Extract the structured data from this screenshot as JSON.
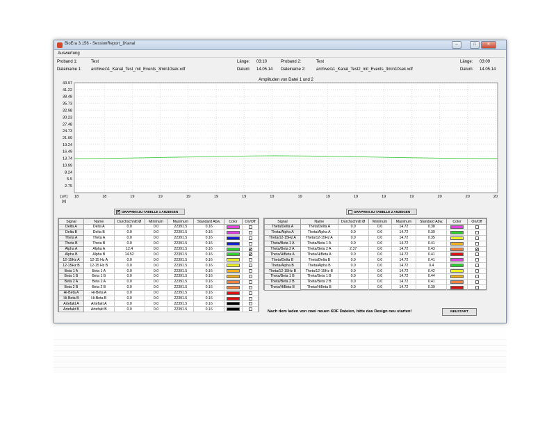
{
  "window": {
    "title": "BioEra 3.156 - SessionReport_1Kanal",
    "min_icon": "minimize-icon",
    "max_icon": "maximize-icon",
    "close_icon": "close-icon"
  },
  "menu": {
    "auswertung": "Auswertung"
  },
  "info": {
    "proband1_label": "Proband 1:",
    "proband1_value": "Test",
    "datei1_label": "Dateiname 1:",
    "datei1_value": "archives\\1_Kanal_Test_mit_Events_3min10sek.xdf",
    "laenge1_label": "Länge:",
    "laenge1_value": "03:10",
    "datum1_label": "Datum:",
    "datum1_value": "14.05.14",
    "proband2_label": "Proband 2:",
    "proband2_value": "Test",
    "datei2_label": "Dateiname 2:",
    "datei2_value": "archives\\1_Kanal_Test2_mit_Events_3min10sek.xdf",
    "laenge2_label": "Länge:",
    "laenge2_value": "03:09",
    "datum2_label": "Datum:",
    "datum2_value": "14.05.14"
  },
  "chart_data": {
    "type": "line",
    "title": "Amplituden von Datei 1 und 2",
    "ylabel": "[uV]",
    "xlabel": "[s]",
    "ylim": [
      0,
      43.97
    ],
    "y_ticks": [
      "43.97",
      "41.22",
      "38.48",
      "35.73",
      "32.98",
      "30.23",
      "27.48",
      "24.73",
      "21.99",
      "19.24",
      "16.49",
      "13.74",
      "10.99",
      "8.24",
      "5.5",
      "2.75"
    ],
    "x_ticks": [
      "18",
      "18",
      "19",
      "19",
      "19",
      "19",
      "19",
      "19",
      "19",
      "19",
      "19",
      "19",
      "19",
      "20",
      "20",
      "20"
    ],
    "grid": true,
    "line_color": "#44cc44",
    "series": [
      {
        "values": [
          13.6,
          13.7,
          13.8,
          13.95,
          14.1,
          14.25,
          14.4,
          14.55,
          14.7,
          14.75,
          14.7,
          14.6,
          14.45,
          14.3,
          14.15,
          14.0,
          13.85,
          13.75,
          13.7,
          13.65
        ]
      }
    ]
  },
  "table1": {
    "toggle_label": "GRAPHEN ZU TABELLE 1 ANZEIGEN",
    "toggle_checked": "✔",
    "headers": [
      "Signal",
      "Name",
      "Durchschnitt Ø",
      "Minimum",
      "Maximum",
      "Standard Abw.",
      "Color",
      "On/Off"
    ],
    "rows": [
      {
        "signal": "Delta A",
        "name": "Delta A",
        "avg": "0.0",
        "min": "0.0",
        "max": "22391.5",
        "std": "0.16",
        "color": "#e040e0",
        "on": ""
      },
      {
        "signal": "Delta B",
        "name": "Delta B",
        "avg": "0.0",
        "min": "0.0",
        "max": "22391.5",
        "std": "0.16",
        "color": "#e040e0",
        "on": ""
      },
      {
        "signal": "Theta A",
        "name": "Theta A",
        "avg": "0.0",
        "min": "0.0",
        "max": "22391.5",
        "std": "0.16",
        "color": "#1020d0",
        "on": ""
      },
      {
        "signal": "Theta B",
        "name": "Theta B",
        "avg": "0.0",
        "min": "0.0",
        "max": "22391.5",
        "std": "0.16",
        "color": "#1020d0",
        "on": ""
      },
      {
        "signal": "Alpha A",
        "name": "Alpha A",
        "avg": "12.4",
        "min": "0.0",
        "max": "22391.5",
        "std": "0.16",
        "color": "#30d030",
        "on": "✔"
      },
      {
        "signal": "Alpha B",
        "name": "Alpha B",
        "avg": "14.52",
        "min": "0.0",
        "max": "22391.5",
        "std": "0.16",
        "color": "#30d030",
        "on": "✔"
      },
      {
        "signal": "12-15Hz A",
        "name": "12-15 Hz A",
        "avg": "0.0",
        "min": "0.0",
        "max": "22391.5",
        "std": "0.16",
        "color": "#f0f020",
        "on": ""
      },
      {
        "signal": "12-15Hz B",
        "name": "12-15 Hz B",
        "avg": "0.0",
        "min": "0.0",
        "max": "22391.5",
        "std": "0.16",
        "color": "#f0f020",
        "on": ""
      },
      {
        "signal": "Beta 1 A",
        "name": "Beta 1 A",
        "avg": "0.0",
        "min": "0.0",
        "max": "22391.5",
        "std": "0.16",
        "color": "#f0b020",
        "on": ""
      },
      {
        "signal": "Beta 1 B",
        "name": "Beta 1 B",
        "avg": "0.0",
        "min": "0.0",
        "max": "22391.5",
        "std": "0.16",
        "color": "#f0b020",
        "on": ""
      },
      {
        "signal": "Beta 2 A",
        "name": "Beta 2 A",
        "avg": "0.0",
        "min": "0.0",
        "max": "22391.5",
        "std": "0.16",
        "color": "#f08040",
        "on": ""
      },
      {
        "signal": "Beta 2 B",
        "name": "Beta 2 B",
        "avg": "0.0",
        "min": "0.0",
        "max": "22391.5",
        "std": "0.16",
        "color": "#f08040",
        "on": ""
      },
      {
        "signal": "Hi-Beta A",
        "name": "Hi-Beta A",
        "avg": "0.0",
        "min": "0.0",
        "max": "22391.5",
        "std": "0.16",
        "color": "#e01010",
        "on": ""
      },
      {
        "signal": "Hi-Beta B",
        "name": "Hi-Beta B",
        "avg": "0.0",
        "min": "0.0",
        "max": "22391.5",
        "std": "0.16",
        "color": "#e01010",
        "on": ""
      },
      {
        "signal": "Artefakt A",
        "name": "Artefakt A",
        "avg": "0.0",
        "min": "0.0",
        "max": "22391.5",
        "std": "0.16",
        "color": "#000000",
        "on": ""
      },
      {
        "signal": "Artefakt B",
        "name": "Artefakt B",
        "avg": "0.0",
        "min": "0.0",
        "max": "22391.5",
        "std": "0.16",
        "color": "#000000",
        "on": ""
      }
    ]
  },
  "table2": {
    "toggle_label": "GRAPHEN ZU TABELLE 2 ANZEIGEN",
    "toggle_checked": "",
    "headers": [
      "Signal",
      "Name",
      "Durchschnitt Ø",
      "Minimum",
      "Maximum",
      "Standard Abw.",
      "Color",
      "On/Off"
    ],
    "rows": [
      {
        "signal": "Theta/Delta A",
        "name": "Theta/Delta A",
        "avg": "0.0",
        "min": "0.0",
        "max": "14.72",
        "std": "0.38",
        "color": "#e040e0",
        "on": ""
      },
      {
        "signal": "Theta/Alpha A",
        "name": "Theta/Alpha A",
        "avg": "0.0",
        "min": "0.0",
        "max": "14.72",
        "std": "0.39",
        "color": "#30d030",
        "on": ""
      },
      {
        "signal": "Theta/12-15Hz A",
        "name": "Theta/12-15Hz A",
        "avg": "0.0",
        "min": "0.0",
        "max": "14.72",
        "std": "0.35",
        "color": "#f0f020",
        "on": ""
      },
      {
        "signal": "Theta/Beta 1 A",
        "name": "Theta/Beta 1 A",
        "avg": "0.0",
        "min": "0.0",
        "max": "14.72",
        "std": "0.41",
        "color": "#f0b020",
        "on": ""
      },
      {
        "signal": "Theta/Beta 2 A",
        "name": "Theta/Beta 2 A",
        "avg": "2.37",
        "min": "0.0",
        "max": "14.72",
        "std": "0.43",
        "color": "#f08040",
        "on": "✔"
      },
      {
        "signal": "Theta/HiBeta A",
        "name": "Theta/HiBeta A",
        "avg": "0.0",
        "min": "0.0",
        "max": "14.72",
        "std": "0.41",
        "color": "#e01010",
        "on": ""
      },
      {
        "signal": "Theta/Delta B",
        "name": "Theta/Delta B",
        "avg": "0.0",
        "min": "0.0",
        "max": "14.72",
        "std": "0.41",
        "color": "#e040e0",
        "on": ""
      },
      {
        "signal": "Theta/Alpha B",
        "name": "Theta/Alpha B",
        "avg": "0.0",
        "min": "0.0",
        "max": "14.72",
        "std": "0.4",
        "color": "#30d030",
        "on": ""
      },
      {
        "signal": "Theta/12-15Hz B",
        "name": "Theta/12-15Hz B",
        "avg": "0.0",
        "min": "0.0",
        "max": "14.72",
        "std": "0.42",
        "color": "#f0f020",
        "on": ""
      },
      {
        "signal": "Theta/Beta 1 B",
        "name": "Theta/Beta 1 B",
        "avg": "0.0",
        "min": "0.0",
        "max": "14.72",
        "std": "0.44",
        "color": "#f0b020",
        "on": ""
      },
      {
        "signal": "Theta/Beta 2 B",
        "name": "Theta/Beta 2 B",
        "avg": "0.0",
        "min": "0.0",
        "max": "14.72",
        "std": "0.41",
        "color": "#f08040",
        "on": ""
      },
      {
        "signal": "Theta/HiBeta B",
        "name": "Theta/HiBeta B",
        "avg": "0.0",
        "min": "0.0",
        "max": "14.72",
        "std": "0.39",
        "color": "#e01010",
        "on": ""
      }
    ]
  },
  "footer": {
    "notice": "Nach dem laden von zwei neuen XDF Dateien, bitte das Design neu starten!",
    "restart_label": "NEUSTART"
  }
}
